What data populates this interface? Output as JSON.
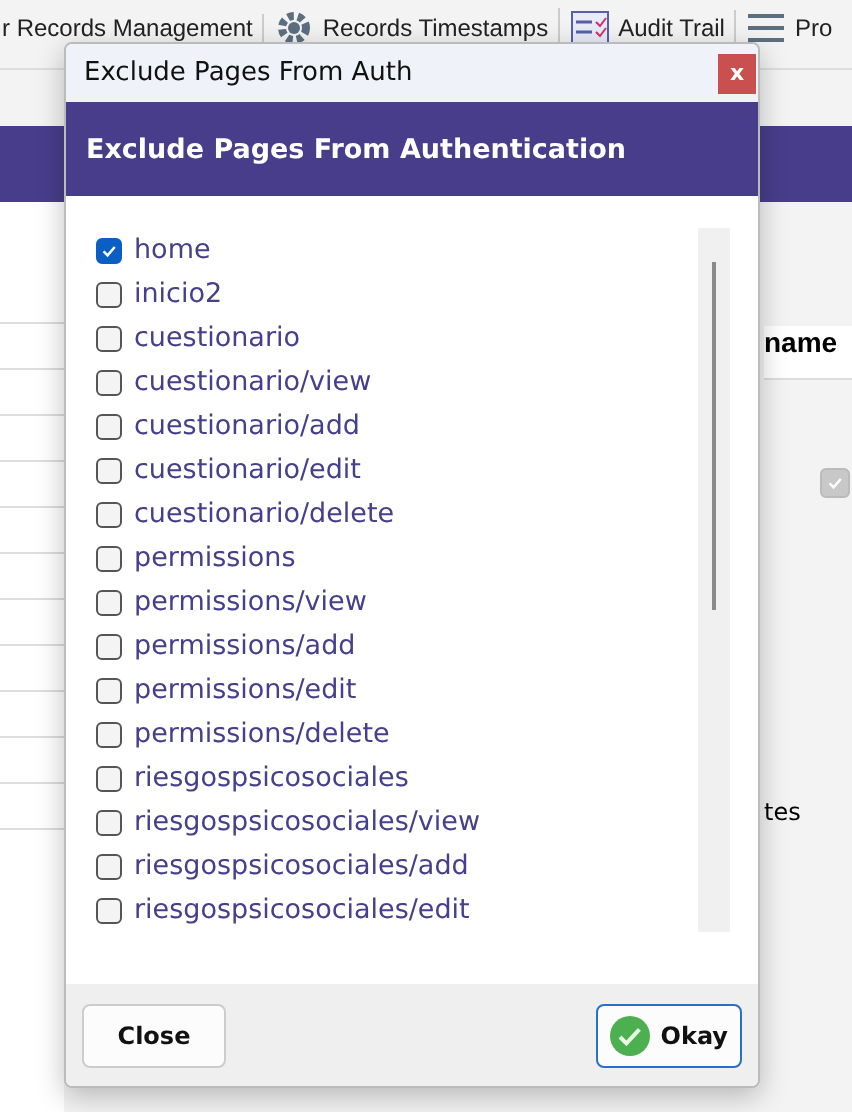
{
  "toolbar": {
    "items": [
      {
        "label": "r Records Management",
        "kind": "plain"
      },
      {
        "label": "Records Timestamps",
        "kind": "gear"
      },
      {
        "label": "Audit Trail",
        "kind": "list"
      },
      {
        "label": "Pro",
        "kind": "menu"
      }
    ]
  },
  "background": {
    "column_header": "name",
    "row_checkbox": {
      "checked": true
    },
    "note": "tes"
  },
  "dialog": {
    "title": "Exclude Pages From Auth",
    "close_label": "x",
    "header": "Exclude Pages From Authentication",
    "pages": [
      {
        "label": "home",
        "checked": true
      },
      {
        "label": "inicio2",
        "checked": false
      },
      {
        "label": "cuestionario",
        "checked": false
      },
      {
        "label": "cuestionario/view",
        "checked": false
      },
      {
        "label": "cuestionario/add",
        "checked": false
      },
      {
        "label": "cuestionario/edit",
        "checked": false
      },
      {
        "label": "cuestionario/delete",
        "checked": false
      },
      {
        "label": "permissions",
        "checked": false
      },
      {
        "label": "permissions/view",
        "checked": false
      },
      {
        "label": "permissions/add",
        "checked": false
      },
      {
        "label": "permissions/edit",
        "checked": false
      },
      {
        "label": "permissions/delete",
        "checked": false
      },
      {
        "label": "riesgospsicosociales",
        "checked": false
      },
      {
        "label": "riesgospsicosociales/view",
        "checked": false
      },
      {
        "label": "riesgospsicosociales/add",
        "checked": false
      },
      {
        "label": "riesgospsicosociales/edit",
        "checked": false
      }
    ],
    "buttons": [
      {
        "label": "Close",
        "kind": "plain"
      },
      {
        "label": "Okay",
        "kind": "confirm"
      }
    ]
  }
}
